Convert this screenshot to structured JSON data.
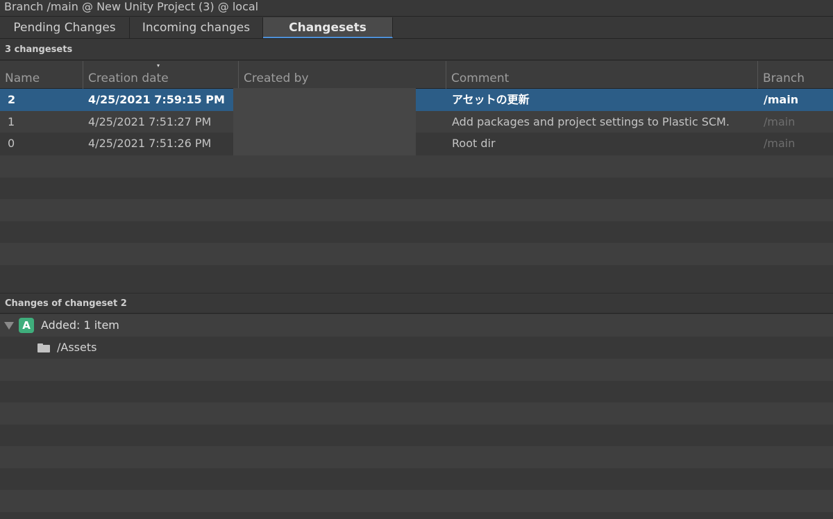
{
  "window": {
    "title": "Branch /main @ New Unity Project (3) @ local"
  },
  "tabs": [
    {
      "label": "Pending Changes",
      "active": false
    },
    {
      "label": "Incoming changes",
      "active": false
    },
    {
      "label": "Changesets",
      "active": true
    }
  ],
  "changesets": {
    "summary": "3 changesets",
    "columns": [
      "Name",
      "Creation date",
      "Created by",
      "Comment",
      "Branch"
    ],
    "sort_column": "Creation date",
    "sort_indicator": "▾",
    "rows": [
      {
        "name": "2",
        "date": "4/25/2021 7:59:15 PM",
        "created_by": "",
        "comment": "アセットの更新",
        "branch": "/main",
        "selected": true
      },
      {
        "name": "1",
        "date": "4/25/2021 7:51:27 PM",
        "created_by": "",
        "comment": "Add packages and project settings to Plastic SCM.",
        "branch": "/main",
        "selected": false
      },
      {
        "name": "0",
        "date": "4/25/2021 7:51:26 PM",
        "created_by": "",
        "comment": "Root dir",
        "branch": "/main",
        "selected": false
      }
    ]
  },
  "changes": {
    "title": "Changes of changeset 2",
    "group": {
      "badge": "A",
      "label": "Added: 1 item",
      "icon": "expand-caret-icon"
    },
    "items": [
      {
        "icon": "folder-icon",
        "path": "/Assets"
      }
    ]
  },
  "colors": {
    "selection": "#2c5d87",
    "added_badge": "#3fae7c",
    "active_tab_underline": "#4d90d8"
  }
}
